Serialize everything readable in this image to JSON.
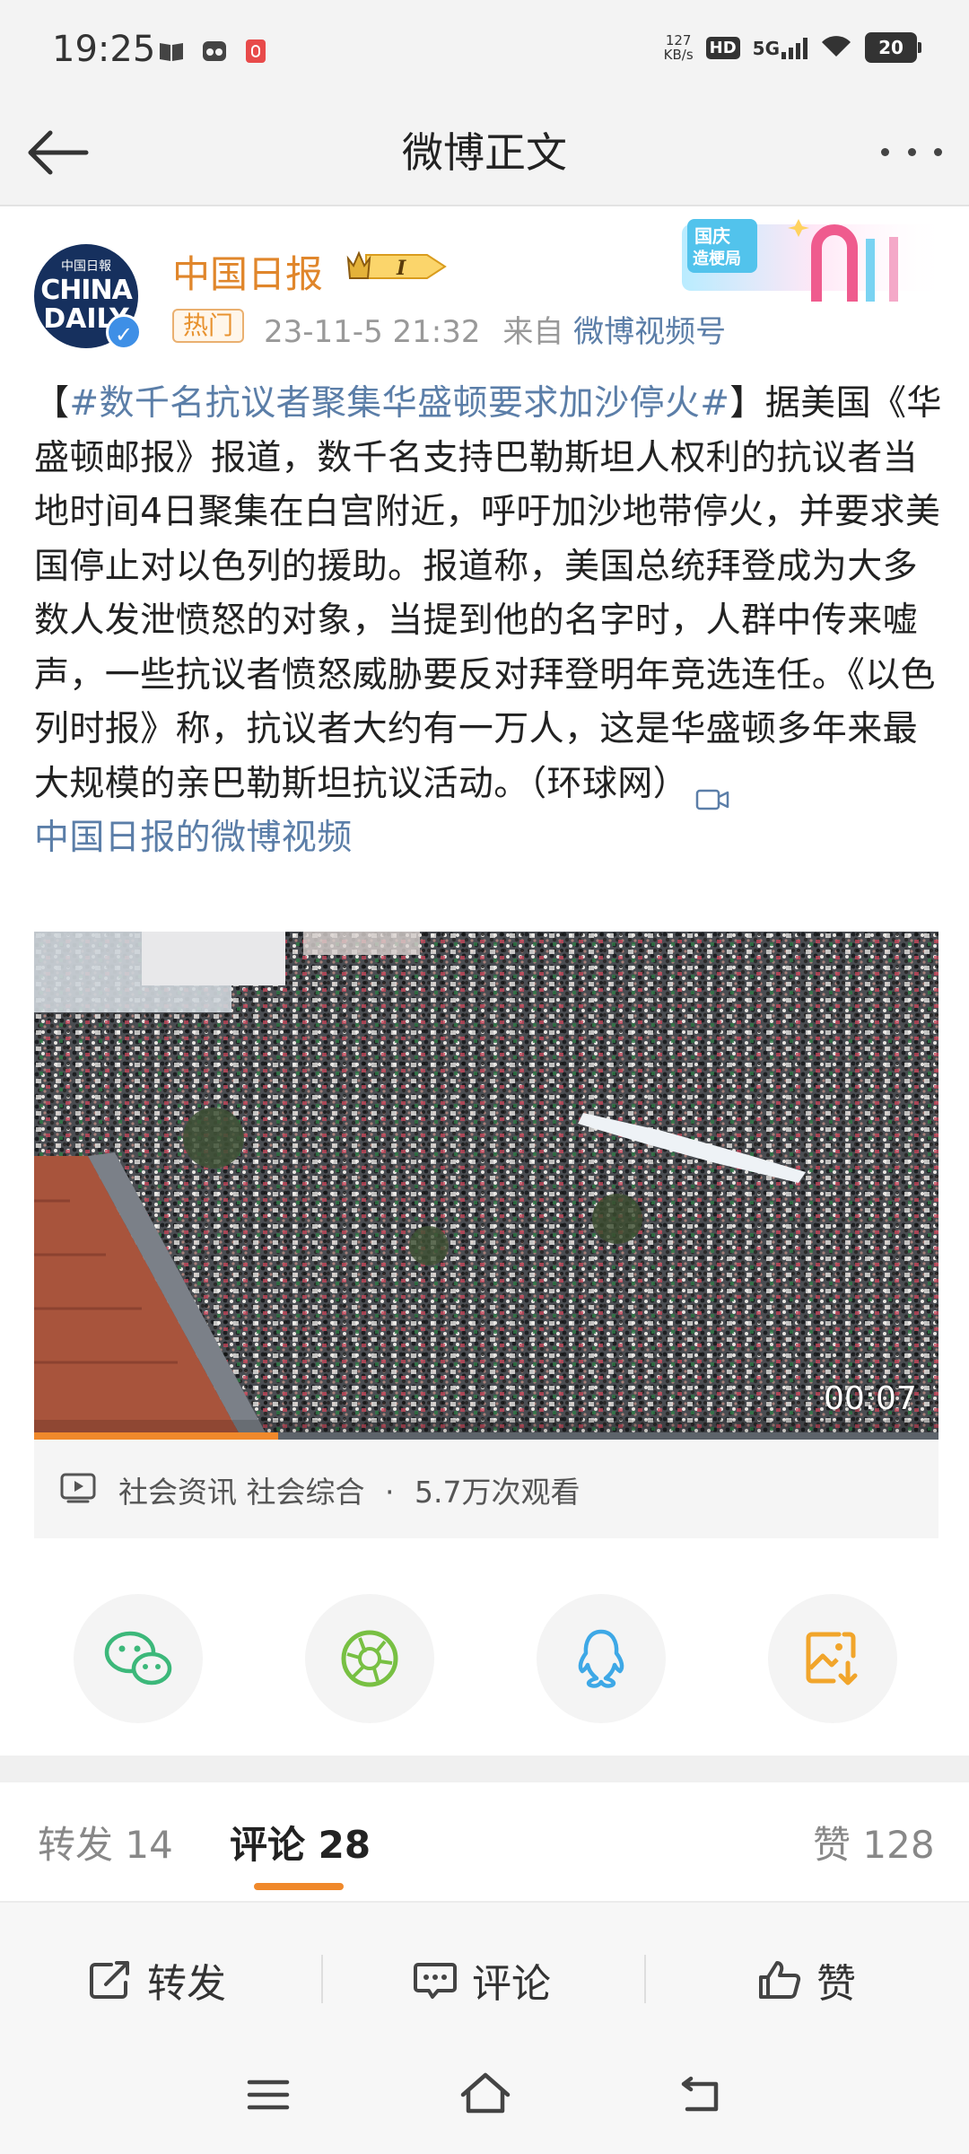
{
  "status_bar": {
    "time": "19:25",
    "net_speed_value": "127",
    "net_speed_unit": "KB/s",
    "hd": "HD",
    "network": "5G",
    "battery": "20"
  },
  "nav": {
    "title": "微博正文"
  },
  "post": {
    "author": "中国日报",
    "avatar_line1": "中国日報",
    "avatar_line2": "CHINA",
    "avatar_line3": "DAILY",
    "level": "I",
    "tag": "热门",
    "timestamp": "23-11-5 21:32",
    "source_prefix": "来自",
    "source": "微博视频号",
    "promo_text_1": "国庆",
    "promo_text_2": "造梗局",
    "bracket_open": "【",
    "topic": "#数千名抗议者聚集华盛顿要求加沙停火#",
    "bracket_close": "】",
    "text": "据美国《华盛顿邮报》报道，数千名支持巴勒斯坦人权利的抗议者当地时间4日聚集在白宫附近，呼吁加沙地带停火，并要求美国停止对以色列的援助。报道称，美国总统拜登成为大多数人发泄愤怒的对象，当提到他的名字时，人群中传来嘘声，一些抗议者愤怒威胁要反对拜登明年竞选连任。《以色列时报》称，抗议者大约有一万人，这是华盛顿多年来最大规模的亲巴勒斯坦抗议活动。（环球网）",
    "video_link": "中国日报的微博视频"
  },
  "video": {
    "duration": "00:07",
    "progress": 0.27,
    "category": "社会资讯 社会综合",
    "dot": "·",
    "views": "5.7万次观看"
  },
  "tabs": {
    "repost_label": "转发",
    "repost_count": "14",
    "comment_label": "评论",
    "comment_count": "28",
    "like_label": "赞",
    "like_count": "128"
  },
  "actions": {
    "repost": "转发",
    "comment": "评论",
    "like": "赞"
  },
  "colors": {
    "accent": "#f0892b",
    "link": "#5b7ea8",
    "wechat": "#3cb87a",
    "moments": "#78c043",
    "qq": "#3ea8e6",
    "save": "#f1a52b"
  }
}
